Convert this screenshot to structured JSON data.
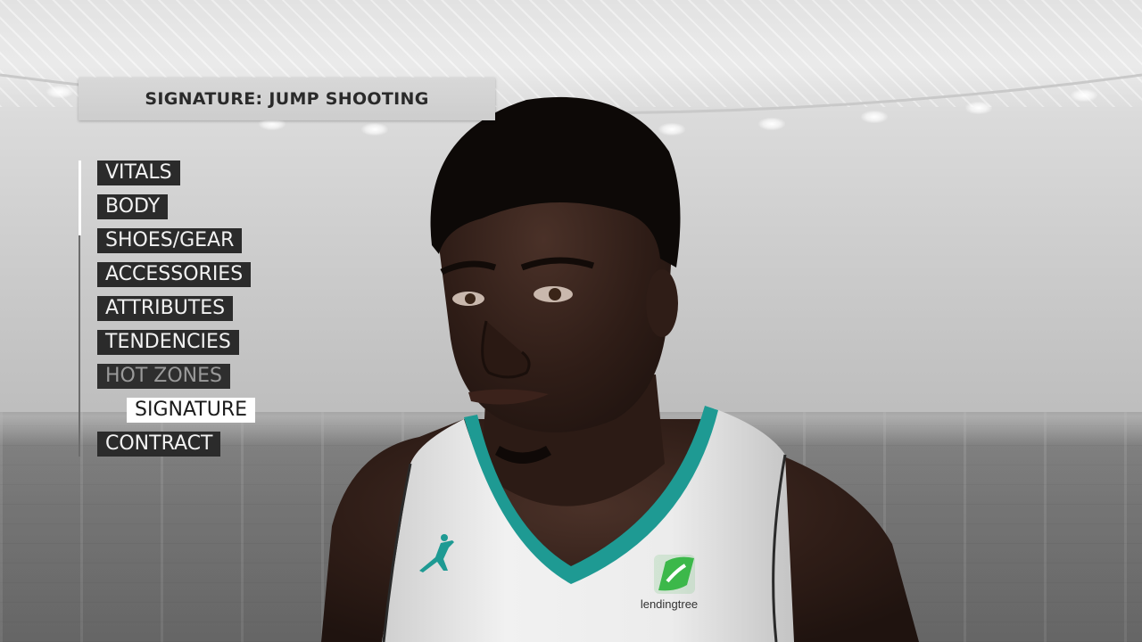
{
  "header": {
    "title": "SIGNATURE: JUMP SHOOTING"
  },
  "menu": {
    "items": [
      {
        "label": "VITALS",
        "state": "normal"
      },
      {
        "label": "BODY",
        "state": "normal"
      },
      {
        "label": "SHOES/GEAR",
        "state": "normal"
      },
      {
        "label": "ACCESSORIES",
        "state": "normal"
      },
      {
        "label": "ATTRIBUTES",
        "state": "normal"
      },
      {
        "label": "TENDENCIES",
        "state": "normal"
      },
      {
        "label": "HOT ZONES",
        "state": "dimmed"
      },
      {
        "label": "SIGNATURE",
        "state": "selected"
      },
      {
        "label": "CONTRACT",
        "state": "normal"
      }
    ]
  },
  "jersey": {
    "sponsor_text": "lendingtree",
    "trim_color": "#1e9a93",
    "sponsor_color": "#3cb84a"
  },
  "colors": {
    "menu_bg": "#2b2b2b",
    "menu_text": "#f2f2f2",
    "selected_bg": "#ffffff",
    "selected_text": "#1a1a1a",
    "title_bg": "#d0d0d0"
  }
}
